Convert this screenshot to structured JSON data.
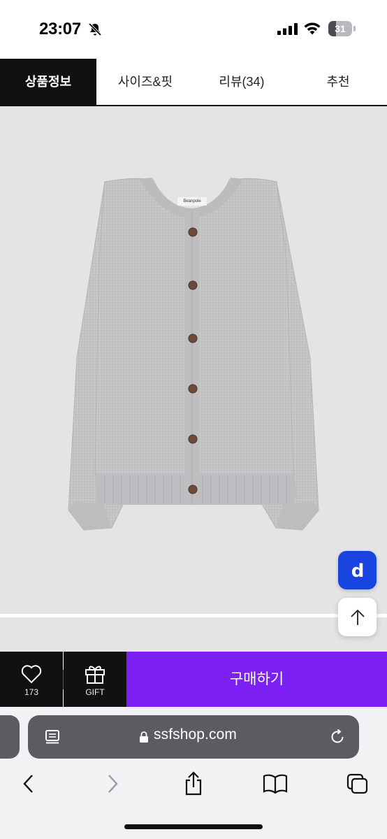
{
  "status_bar": {
    "time": "23:07",
    "battery": "31",
    "battery_level": 0.31
  },
  "tabs": [
    {
      "label": "상품정보",
      "active": true
    },
    {
      "label": "사이즈&핏",
      "active": false
    },
    {
      "label": "리뷰(34)",
      "active": false
    },
    {
      "label": "추천",
      "active": false
    }
  ],
  "product": {
    "image": "gray-knit-cardigan",
    "label_text": "Beanpole"
  },
  "floating": {
    "d_button_label": "d",
    "d_icon": "d-logo-icon",
    "up_icon": "arrow-up-icon"
  },
  "buy_bar": {
    "wish_count": "173",
    "gift_label": "GIFT",
    "buy_label": "구매하기",
    "buy_color": "#7c1ff2",
    "bar_color": "#111111"
  },
  "browser": {
    "url": "ssfshop.com",
    "accent": "#5b5b60"
  },
  "toolbar": [
    "back-icon",
    "forward-icon",
    "share-icon",
    "bookmarks-icon",
    "tabs-icon"
  ]
}
